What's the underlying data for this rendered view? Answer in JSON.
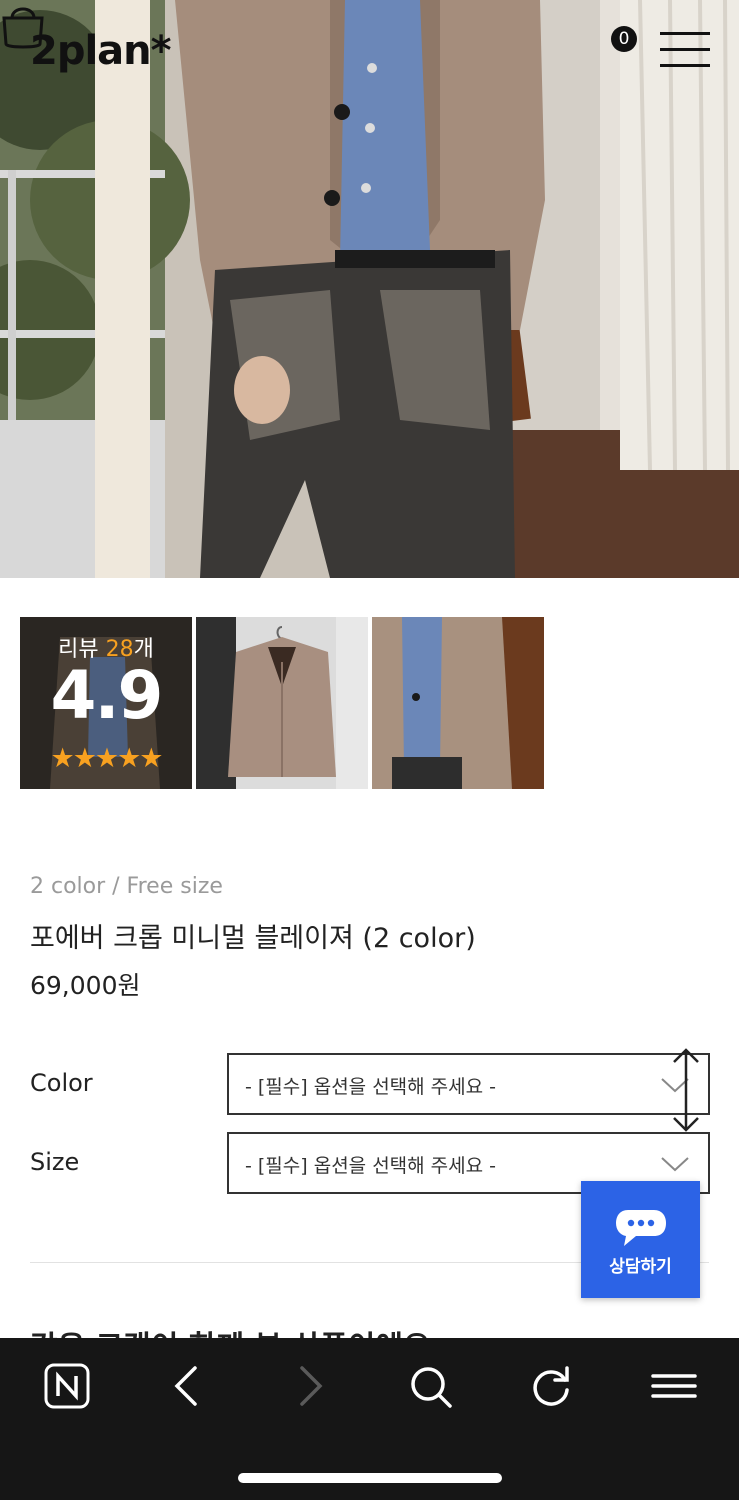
{
  "header": {
    "logo": "2plan*",
    "cart_count": "0",
    "icons": [
      "cart-icon",
      "hamburger-menu-icon"
    ]
  },
  "thumbnails": {
    "review_prefix": "리뷰",
    "review_count": "28",
    "review_suffix": "개",
    "review_score": "4.9",
    "review_stars": "★★★★★",
    "star_color": "#f8a120"
  },
  "product": {
    "subtitle": "2 color / Free size",
    "name": "포에버 크롭 미니멀 블레이져 (2 color)",
    "price": "69,000원"
  },
  "options": [
    {
      "label": "Color",
      "placeholder": "- [필수] 옵션을 선택해 주세요 -"
    },
    {
      "label": "Size",
      "placeholder": "- [필수] 옵션을 선택해 주세요 -"
    }
  ],
  "next_section_heading": "같은 고객이 함께 본 상품이에요",
  "chat": {
    "label": "상담하기",
    "color": "#2c63e6"
  },
  "browser_bar": {
    "icons": [
      "naver-home-icon",
      "back-icon",
      "forward-icon",
      "search-icon",
      "refresh-icon",
      "menu-icon"
    ]
  }
}
